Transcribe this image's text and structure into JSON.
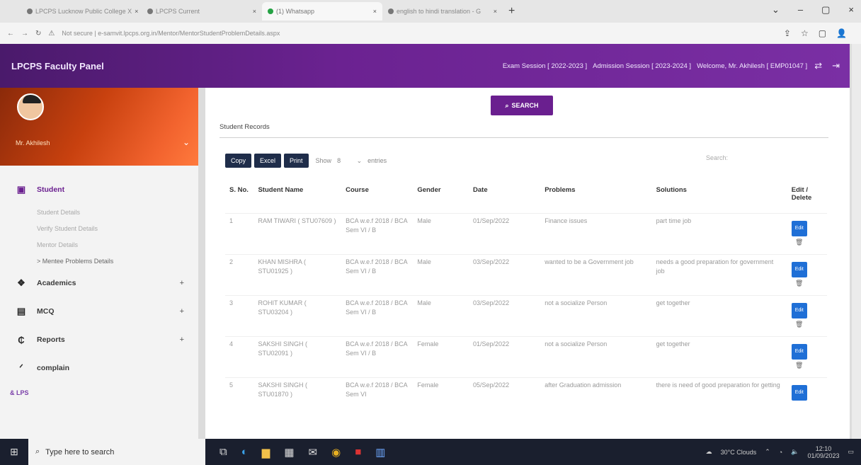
{
  "browser": {
    "tabs": [
      {
        "label": "LPCPS Lucknow Public College X",
        "active": false
      },
      {
        "label": "LPCPS Current",
        "active": false
      },
      {
        "label": "(1) Whatsapp",
        "active": true
      },
      {
        "label": "english to hindi translation - G",
        "active": false
      }
    ],
    "url": "Not secure | e-samvit.lpcps.org.in/Mentor/MentorStudentProblemDetails.aspx"
  },
  "topnav": {
    "brand": "LPCPS Faculty Panel",
    "exam_session": "Exam Session [ 2022-2023 ]",
    "admission_session": "Admission Session [ 2023-2024 ]",
    "welcome": "Welcome, Mr. Akhilesh [ EMP01047 ]"
  },
  "sidebar": {
    "profile_name": "Mr. Akhilesh",
    "student_label": "Student",
    "student_sub": [
      "Student Details",
      "Verify Student Details",
      "Mentor Details",
      "> Mentee Problems Details"
    ],
    "academics": "Academics",
    "mcq": "MCQ",
    "reports": "Reports",
    "complain": "complain",
    "lps": "& LPS"
  },
  "main": {
    "search_label": "SEARCH",
    "records_title": "Student Records",
    "copy_label": "Copy",
    "excel_label": "Excel",
    "print_label": "Print",
    "show_label": "Show",
    "show_value": "8",
    "entries_label": "entries",
    "search_placeholder": "Search:",
    "columns": [
      "S. No.",
      "Student Name",
      "Course",
      "Gender",
      "Date",
      "Problems",
      "Solutions",
      "Edit / Delete"
    ],
    "rows": [
      {
        "sno": "1",
        "name": "RAM TIWARI ( STU07609 )",
        "course": "BCA w.e.f 2018 / BCA Sem VI / B",
        "gender": "Male",
        "date": "01/Sep/2022",
        "problem": "Finance issues",
        "solution": "part time job"
      },
      {
        "sno": "2",
        "name": "KHAN MISHRA ( STU01925 )",
        "course": "BCA w.e.f 2018 / BCA Sem VI / B",
        "gender": "Male",
        "date": "03/Sep/2022",
        "problem": "wanted to be a Government job",
        "solution": "needs a good preparation for government job"
      },
      {
        "sno": "3",
        "name": "ROHIT KUMAR ( STU03204 )",
        "course": "BCA w.e.f 2018 / BCA Sem VI / B",
        "gender": "Male",
        "date": "03/Sep/2022",
        "problem": "not a socialize Person",
        "solution": "get together"
      },
      {
        "sno": "4",
        "name": "SAKSHI SINGH ( STU02091 )",
        "course": "BCA w.e.f 2018 / BCA Sem VI / B",
        "gender": "Female",
        "date": "01/Sep/2022",
        "problem": "not a socialize Person",
        "solution": "get together"
      },
      {
        "sno": "5",
        "name": "SAKSHI SINGH ( STU01870 )",
        "course": "BCA w.e.f 2018 / BCA Sem VI",
        "gender": "Female",
        "date": "05/Sep/2022",
        "problem": "after Graduation admission",
        "solution": "there is need of good preparation for getting"
      }
    ],
    "edit_label": "Edit"
  },
  "taskbar": {
    "search_placeholder": "Type here to search",
    "weather": "30°C Clouds",
    "time": "12:10",
    "date": "01/09/2023"
  }
}
